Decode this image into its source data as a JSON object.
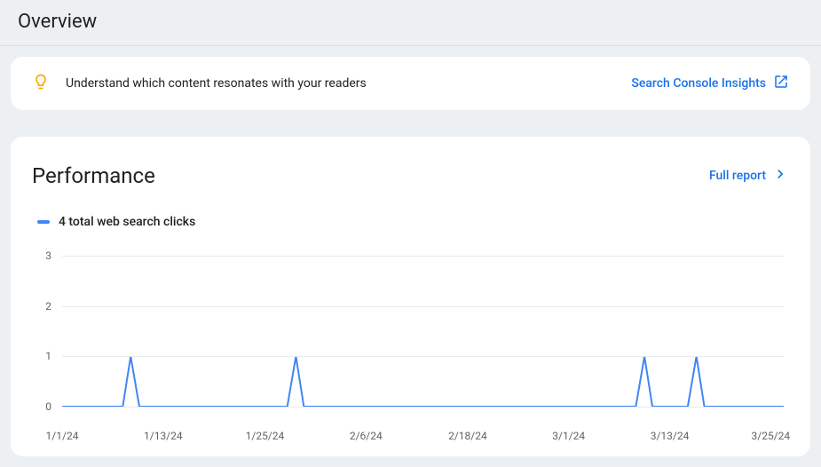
{
  "page": {
    "title": "Overview"
  },
  "insights": {
    "text": "Understand which content resonates with your readers",
    "link_label": "Search Console Insights"
  },
  "performance": {
    "title": "Performance",
    "full_report_label": "Full report",
    "legend_label": "4 total web search clicks"
  },
  "chart_data": {
    "type": "line",
    "title": "Performance",
    "ylabel": "",
    "xlabel": "",
    "ylim": [
      0,
      3
    ],
    "y_ticks": [
      0,
      1,
      2,
      3
    ],
    "x_tick_labels": [
      "1/1/24",
      "1/13/24",
      "1/25/24",
      "2/6/24",
      "2/18/24",
      "3/1/24",
      "3/13/24",
      "3/25/24"
    ],
    "x_tick_positions": [
      0.0,
      0.14,
      0.281,
      0.421,
      0.562,
      0.702,
      0.842,
      0.982
    ],
    "series": [
      {
        "name": "Web search clicks",
        "color": "#4285f4",
        "x": [
          0.0,
          0.084,
          0.095,
          0.107,
          0.312,
          0.324,
          0.335,
          0.795,
          0.807,
          0.818,
          0.867,
          0.879,
          0.89,
          1.0
        ],
        "y": [
          0,
          0,
          1,
          0,
          0,
          1,
          0,
          0,
          1,
          0,
          0,
          1,
          0,
          0
        ]
      }
    ]
  }
}
